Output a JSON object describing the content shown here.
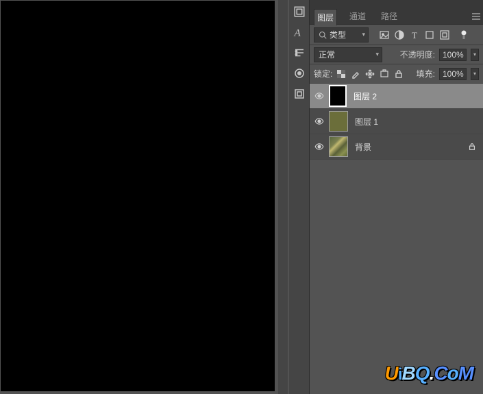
{
  "panel": {
    "tabs": {
      "layers": "图层",
      "channels": "通道",
      "paths": "路径"
    },
    "filter": {
      "type_label": "类型"
    },
    "blend": {
      "mode_label": "正常",
      "opacity_label": "不透明度:",
      "opacity_value": "100%"
    },
    "lock": {
      "label": "锁定:",
      "fill_label": "填充:",
      "fill_value": "100%"
    },
    "layers": [
      {
        "name": "图层 2",
        "selected": true,
        "thumb": "black",
        "locked": false
      },
      {
        "name": "图层 1",
        "selected": false,
        "thumb": "olive",
        "locked": false
      },
      {
        "name": "背景",
        "selected": false,
        "thumb": "bg",
        "locked": true
      }
    ]
  },
  "icons": {
    "image_filter": "image-icon",
    "adjustment_filter": "adjust-icon",
    "text_filter": "text-icon",
    "shape_filter": "shape-icon",
    "smart_filter": "smart-icon"
  },
  "watermark": "UiBQ.CoM"
}
